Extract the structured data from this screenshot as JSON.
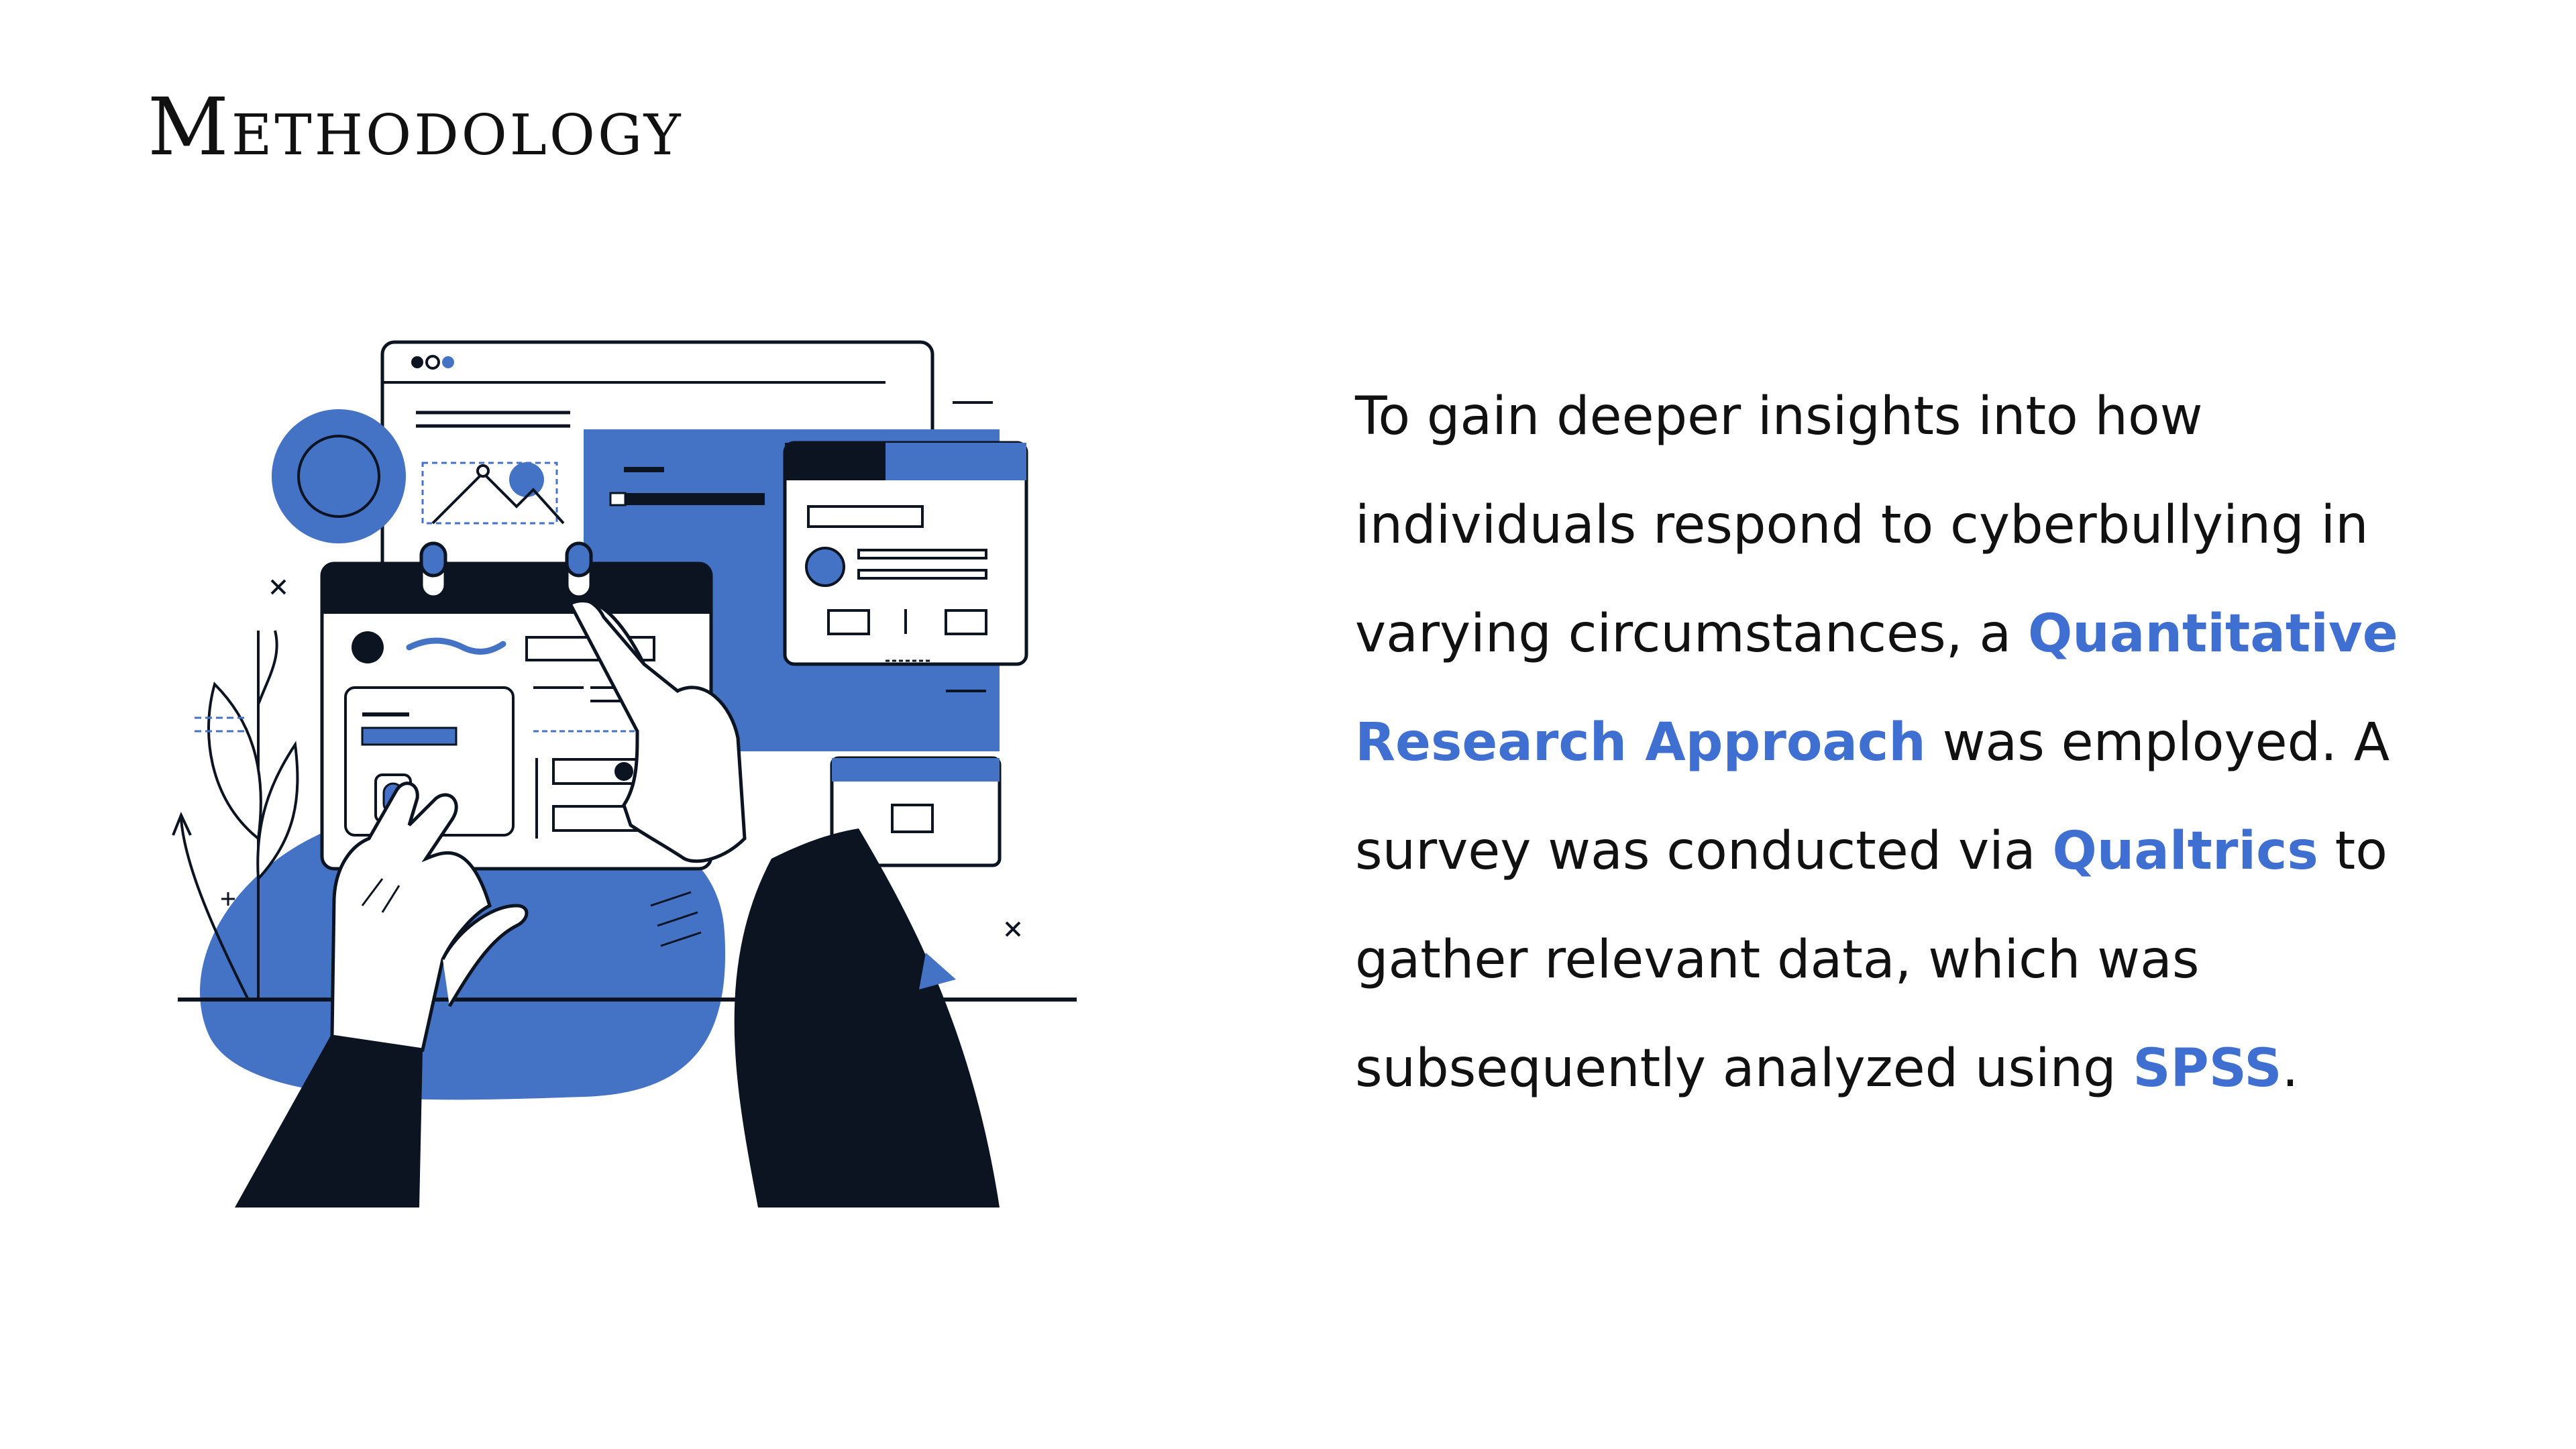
{
  "slide": {
    "title": "Methodology",
    "illustration_icon": "hands-using-web-forms-illustration",
    "body": {
      "t1": "To gain deeper insights into how individuals respond to cyberbullying in varying circumstances, a ",
      "h1": "Quantitative Research Approach",
      "t2": " was employed. A survey was conducted via ",
      "h2": "Qualtrics",
      "t3": " to gather relevant data, which was subsequently analyzed using ",
      "h3": "SPSS",
      "t4": "."
    }
  },
  "colors": {
    "accent": "#4472C4",
    "dark": "#0B1420",
    "text": "#111111",
    "background": "#FFFFFF"
  }
}
